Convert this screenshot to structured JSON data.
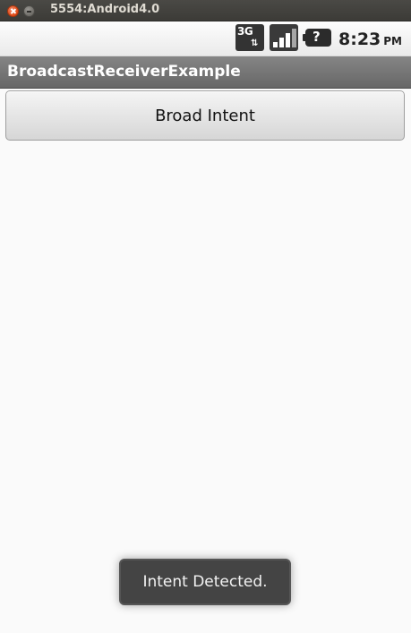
{
  "window": {
    "title": "5554:Android4.0"
  },
  "status_bar": {
    "network_label": "3G",
    "time": "8:23",
    "ampm": "PM",
    "icons": [
      "network-3g-icon",
      "signal-strength-icon",
      "battery-unknown-icon"
    ]
  },
  "app": {
    "title": "BroadcastReceiverExample"
  },
  "main": {
    "button_label": "Broad Intent"
  },
  "toast": {
    "message": "Intent Detected."
  }
}
